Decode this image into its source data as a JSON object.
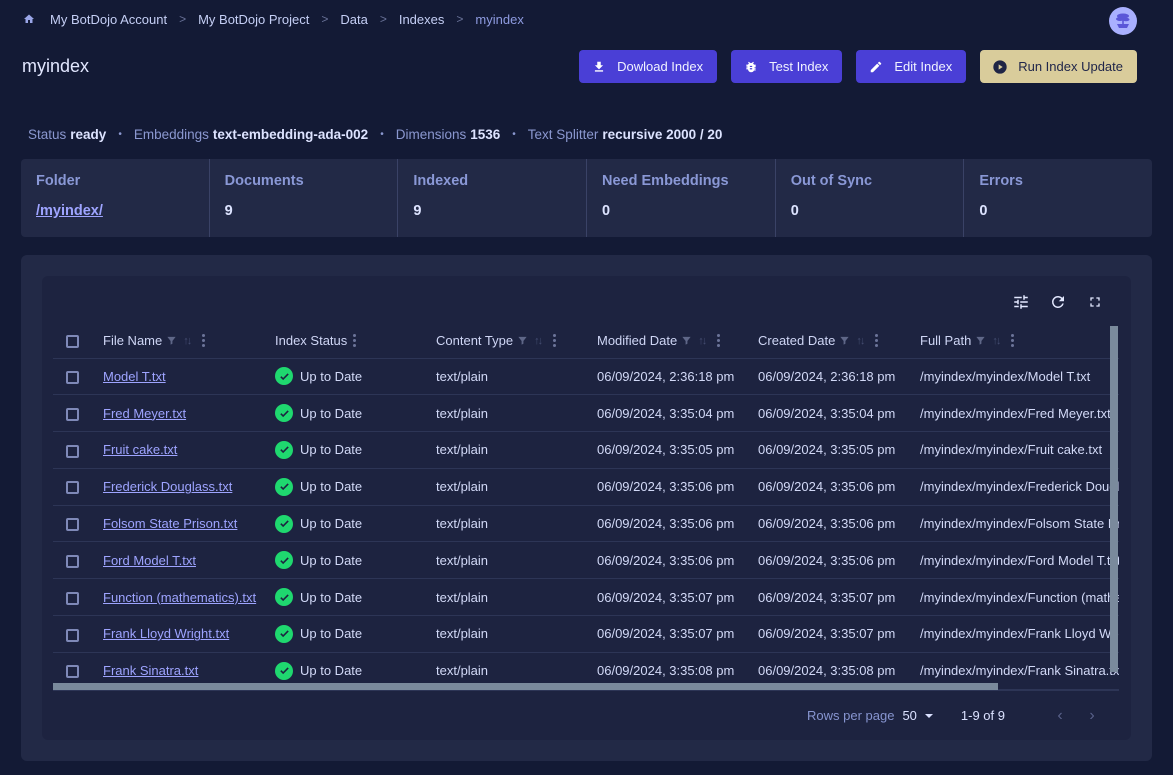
{
  "breadcrumb": {
    "home_icon": "home-icon",
    "items": [
      "My BotDojo Account",
      "My BotDojo Project",
      "Data",
      "Indexes",
      "myindex"
    ],
    "separator": ">"
  },
  "avatar": {
    "icon": "bonsai-logo-icon"
  },
  "page": {
    "title": "myindex"
  },
  "actions": {
    "download": {
      "label": "Dowload Index",
      "icon": "download-icon"
    },
    "test": {
      "label": "Test Index",
      "icon": "bug-icon"
    },
    "edit": {
      "label": "Edit Index",
      "icon": "pencil-icon"
    },
    "run": {
      "label": "Run Index Update",
      "icon": "play-circle-icon"
    }
  },
  "meta": {
    "status_label": "Status",
    "status_value": "ready",
    "embeddings_label": "Embeddings",
    "embeddings_value": "text-embedding-ada-002",
    "dimensions_label": "Dimensions",
    "dimensions_value": "1536",
    "splitter_label": "Text Splitter",
    "splitter_value": "recursive 2000 / 20",
    "separator": "•"
  },
  "stats": [
    {
      "label": "Folder",
      "value": "/myindex/"
    },
    {
      "label": "Documents",
      "value": "9"
    },
    {
      "label": "Indexed",
      "value": "9"
    },
    {
      "label": "Need Embeddings",
      "value": "0"
    },
    {
      "label": "Out of Sync",
      "value": "0"
    },
    {
      "label": "Errors",
      "value": "0"
    }
  ],
  "toolbar": {
    "icons": [
      "column-settings-icon",
      "refresh-icon",
      "fullscreen-icon"
    ]
  },
  "colors": {
    "accent": "#4a3fd6",
    "warn": "#d9cc9b",
    "success": "#1fd86f",
    "link": "#9ea4ff"
  },
  "table": {
    "columns": [
      "File Name",
      "Index Status",
      "Content Type",
      "Modified Date",
      "Created Date",
      "Full Path"
    ],
    "rows": [
      {
        "name": "Model T.txt",
        "status": "Up to Date",
        "type": "text/plain",
        "modified": "06/09/2024, 2:36:18 pm",
        "created": "06/09/2024, 2:36:18 pm",
        "path": "/myindex/myindex/Model T.txt"
      },
      {
        "name": "Fred Meyer.txt",
        "status": "Up to Date",
        "type": "text/plain",
        "modified": "06/09/2024, 3:35:04 pm",
        "created": "06/09/2024, 3:35:04 pm",
        "path": "/myindex/myindex/Fred Meyer.txt"
      },
      {
        "name": "Fruit cake.txt",
        "status": "Up to Date",
        "type": "text/plain",
        "modified": "06/09/2024, 3:35:05 pm",
        "created": "06/09/2024, 3:35:05 pm",
        "path": "/myindex/myindex/Fruit cake.txt"
      },
      {
        "name": "Frederick Douglass.txt",
        "status": "Up to Date",
        "type": "text/plain",
        "modified": "06/09/2024, 3:35:06 pm",
        "created": "06/09/2024, 3:35:06 pm",
        "path": "/myindex/myindex/Frederick Douglass.txt"
      },
      {
        "name": "Folsom State Prison.txt",
        "status": "Up to Date",
        "type": "text/plain",
        "modified": "06/09/2024, 3:35:06 pm",
        "created": "06/09/2024, 3:35:06 pm",
        "path": "/myindex/myindex/Folsom State Prison.txt"
      },
      {
        "name": "Ford Model T.txt",
        "status": "Up to Date",
        "type": "text/plain",
        "modified": "06/09/2024, 3:35:06 pm",
        "created": "06/09/2024, 3:35:06 pm",
        "path": "/myindex/myindex/Ford Model T.txt"
      },
      {
        "name": "Function (mathematics).txt",
        "status": "Up to Date",
        "type": "text/plain",
        "modified": "06/09/2024, 3:35:07 pm",
        "created": "06/09/2024, 3:35:07 pm",
        "path": "/myindex/myindex/Function (mathematics).txt"
      },
      {
        "name": "Frank Lloyd Wright.txt",
        "status": "Up to Date",
        "type": "text/plain",
        "modified": "06/09/2024, 3:35:07 pm",
        "created": "06/09/2024, 3:35:07 pm",
        "path": "/myindex/myindex/Frank Lloyd Wright.txt"
      },
      {
        "name": "Frank Sinatra.txt",
        "status": "Up to Date",
        "type": "text/plain",
        "modified": "06/09/2024, 3:35:08 pm",
        "created": "06/09/2024, 3:35:08 pm",
        "path": "/myindex/myindex/Frank Sinatra.txt"
      }
    ]
  },
  "pagination": {
    "rows_per_page_label": "Rows per page",
    "rows_per_page_value": "50",
    "range": "1-9 of 9",
    "prev": "‹",
    "next": "›"
  }
}
